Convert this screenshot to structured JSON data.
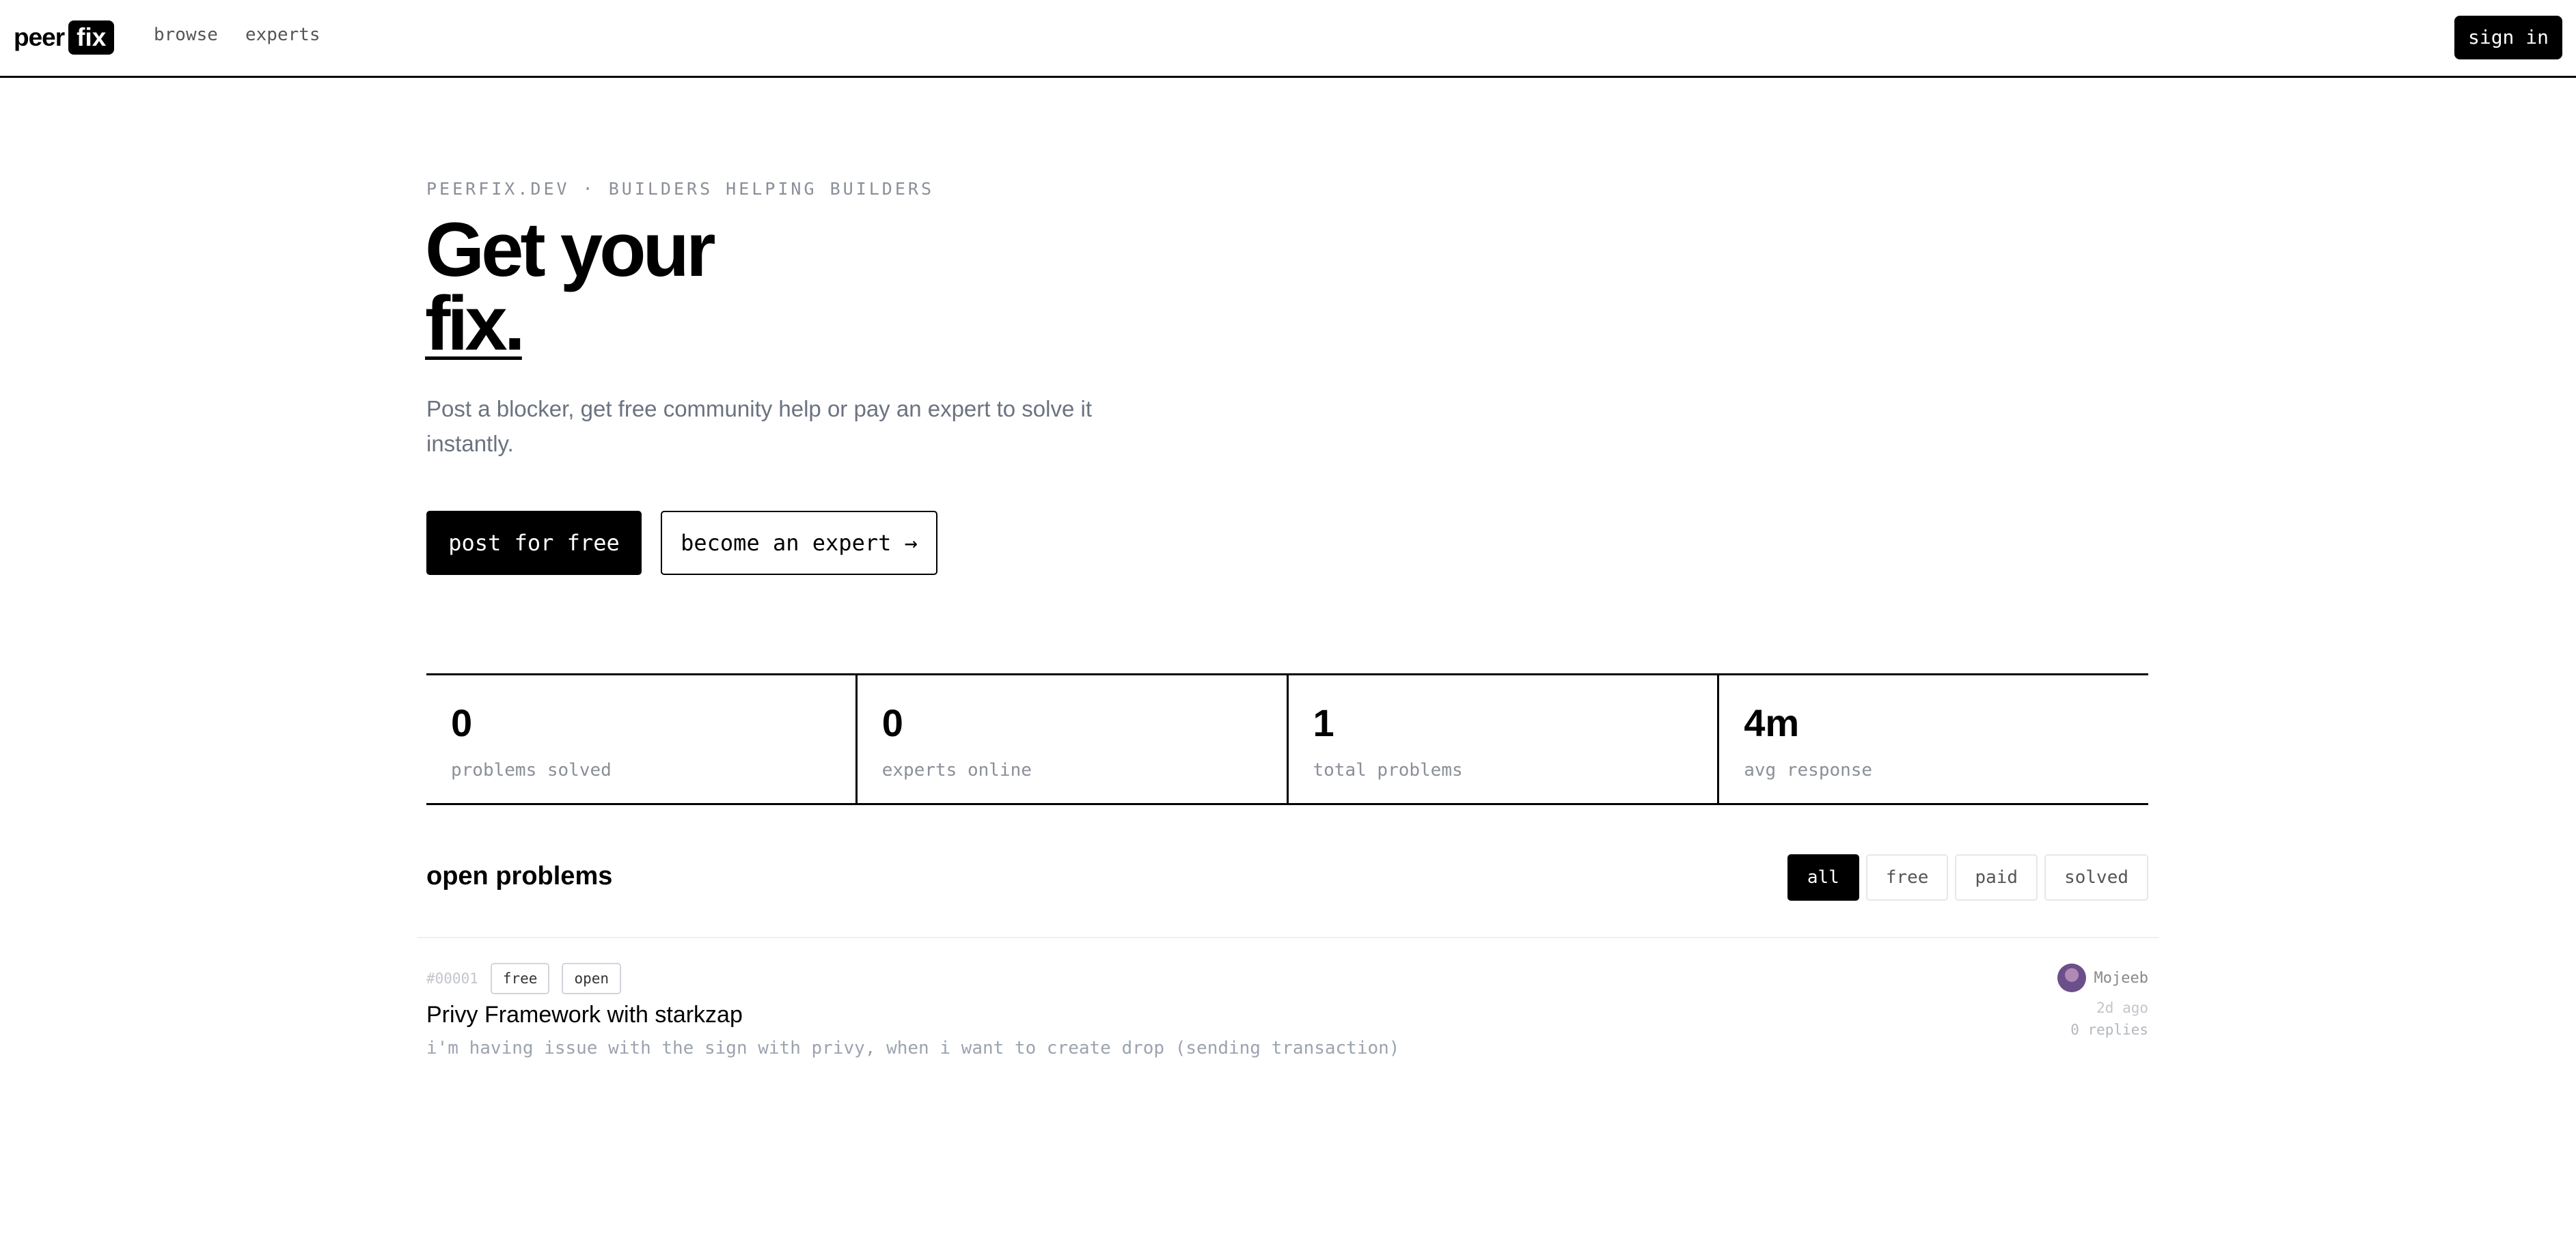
{
  "nav": {
    "logo_peer": "peer",
    "logo_fix": "fix",
    "links": [
      "browse",
      "experts"
    ],
    "signin": "sign in"
  },
  "hero": {
    "eyebrow": "PEERFIX.DEV · BUILDERS HELPING BUILDERS",
    "title_line1": "Get your",
    "title_line2": "fix.",
    "subtitle": "Post a blocker, get free community help or pay an expert to solve it instantly.",
    "primary_button": "post for free",
    "secondary_button": "become an expert →"
  },
  "stats": [
    {
      "value": "0",
      "label": "problems solved"
    },
    {
      "value": "0",
      "label": "experts online"
    },
    {
      "value": "1",
      "label": "total problems"
    },
    {
      "value": "4m",
      "label": "avg response"
    }
  ],
  "problems": {
    "title": "open problems",
    "filters": [
      "all",
      "free",
      "paid",
      "solved"
    ],
    "active_filter": "all",
    "items": [
      {
        "id": "#00001",
        "tags": [
          "free",
          "open"
        ],
        "title": "Privy Framework with starkzap",
        "description": "i'm having issue with the sign with privy, when i want to create drop (sending transaction)",
        "author": "Mojeeb",
        "time": "2d ago",
        "replies": "0 replies"
      }
    ]
  },
  "colors": {
    "accent": "#000000",
    "muted": "#8a8f98",
    "border": "#e5e7eb"
  }
}
